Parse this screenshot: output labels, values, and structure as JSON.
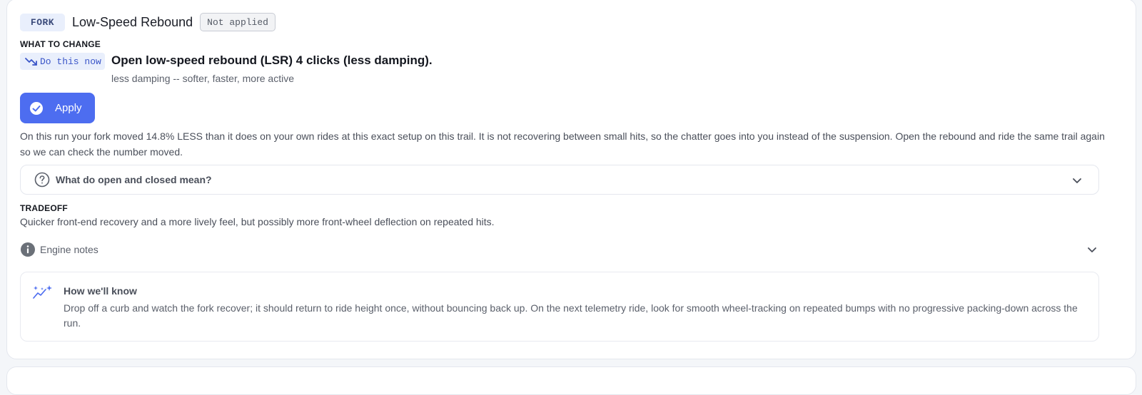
{
  "header": {
    "part_badge": "FORK",
    "title": "Low-Speed Rebound",
    "status": "Not applied"
  },
  "what_to_change": {
    "label": "WHAT TO CHANGE",
    "priority_badge": "Do this now",
    "priority_icon": "trending-down-icon",
    "instruction": "Open low-speed rebound (LSR) 4 clicks (less damping).",
    "effect": "less damping -- softer, faster, more active"
  },
  "apply_button": {
    "label": "Apply",
    "icon": "check-circle-icon"
  },
  "explanation": "On this run your fork moved 14.8% LESS than it does on your own rides at this exact setup on this trail. It is not recovering between small hits, so the chatter goes into you instead of the suspension. Open the rebound and ride the same trail again so we can check the number moved.",
  "faq": {
    "label": "What do open and closed mean?",
    "icon": "question-circle-icon"
  },
  "tradeoff": {
    "label": "TRADEOFF",
    "text": "Quicker front-end recovery and a more lively feel, but possibly more front-wheel deflection on repeated hits."
  },
  "engine_notes": {
    "label": "Engine notes",
    "icon": "info-icon"
  },
  "how_we_know": {
    "title": "How we'll know",
    "icon": "sparkle-trend-icon",
    "text": "Drop off a curb and watch the fork recover; it should return to ride height once, without bouncing back up. On the next telemetry ride, look for smooth wheel-tracking on repeated bumps with no progressive packing-down across the run."
  },
  "colors": {
    "accent": "#4d6df0",
    "badge_bg": "#e9effc",
    "text_muted": "#5b606b"
  }
}
